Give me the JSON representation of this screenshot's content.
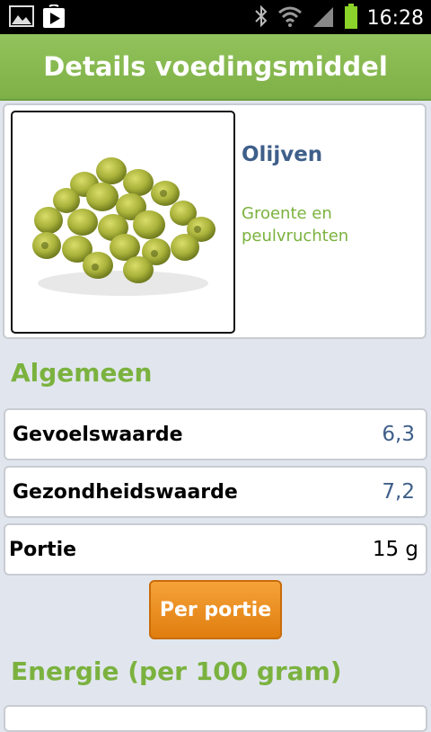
{
  "status_bar": {
    "time": "16:28"
  },
  "header": {
    "title": "Details voedingsmiddel"
  },
  "food": {
    "name": "Olijven",
    "category": "Groente en peulvruchten"
  },
  "sections": {
    "general": "Algemeen",
    "energy": "Energie (per 100 gram)"
  },
  "rows": [
    {
      "label": "Gevoelswaarde",
      "value": "6,3"
    },
    {
      "label": "Gezondheidswaarde",
      "value": "7,2"
    },
    {
      "label": "Portie",
      "value": "15 g"
    }
  ],
  "buttons": {
    "per_portion": "Per portie"
  },
  "colors": {
    "accent_green": "#7bb23f",
    "value_blue": "#3f5f8a",
    "button_orange": "#e8891c"
  }
}
